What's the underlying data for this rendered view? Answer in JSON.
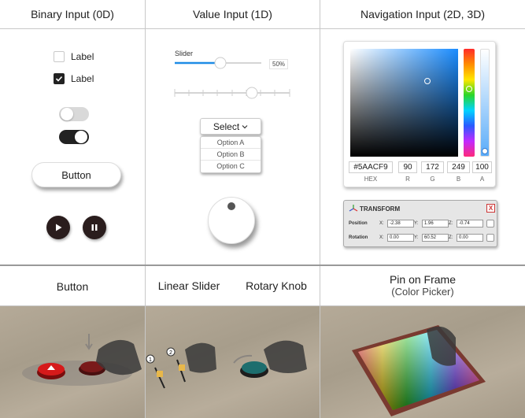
{
  "headers": {
    "col1": "Binary Input (0D)",
    "col2": "Value Input (1D)",
    "col3": "Navigation Input (2D, 3D)"
  },
  "binary": {
    "checkbox1_label": "Label",
    "checkbox2_label": "Label",
    "button_label": "Button"
  },
  "value": {
    "slider_label": "Slider",
    "slider_value": "50%",
    "select_label": "Select",
    "options": [
      "Option A",
      "Option B",
      "Option C"
    ]
  },
  "picker": {
    "hex": "#5AACF9",
    "r": "90",
    "g": "172",
    "b": "249",
    "a": "100",
    "hex_label": "HEX",
    "r_label": "R",
    "g_label": "G",
    "b_label": "B",
    "a_label": "A",
    "color": "#5aacf9"
  },
  "transform": {
    "title": "TRANSFORM",
    "close": "X",
    "position_label": "Position",
    "rotation_label": "Rotation",
    "x_axis": "X:",
    "y_axis": "Y:",
    "z_axis": "Z:",
    "pos_x": "-2.38",
    "pos_y": "1.96",
    "pos_z": "-0.74",
    "rot_x": "0.00",
    "rot_y": "60.52",
    "rot_z": "0.00"
  },
  "captions": {
    "button": "Button",
    "linear_slider": "Linear Slider",
    "rotary_knob": "Rotary Knob",
    "pin_frame": "Pin on Frame",
    "pin_frame_sub": "(Color Picker)"
  },
  "steps": {
    "step1": "1",
    "step2": "2"
  }
}
